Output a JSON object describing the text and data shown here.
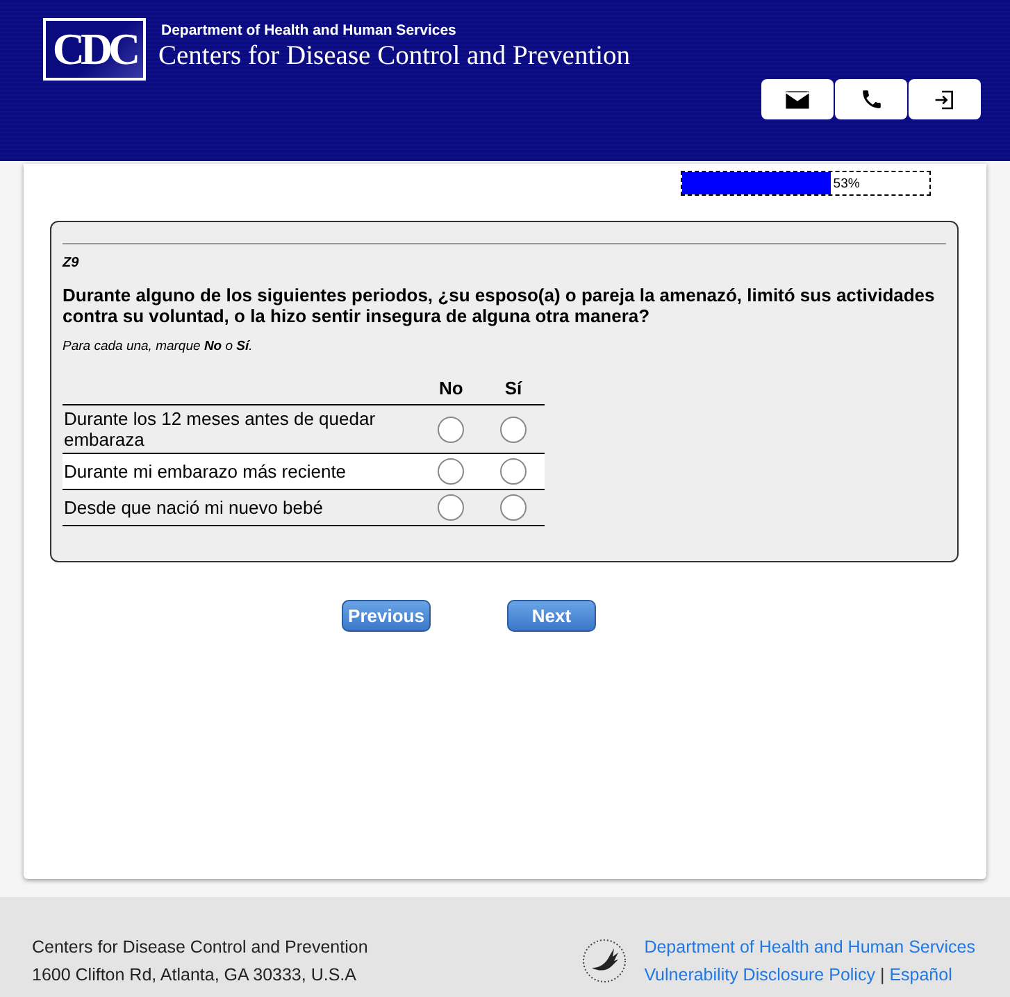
{
  "header": {
    "logo": "CDC",
    "department": "Department of Health and Human Services",
    "agency": "Centers for Disease Control and Prevention",
    "actions": [
      {
        "kind": "email"
      },
      {
        "kind": "phone"
      },
      {
        "kind": "exit"
      }
    ]
  },
  "progress": {
    "level": 0.6,
    "reading": "53%"
  },
  "question": {
    "code": "Z9",
    "text": "Durante alguno de los siguientes periodos, ¿su esposo(a) o pareja la amenazó, limitó sus actividades contra su voluntad, o la hizo sentir insegura de alguna otra manera?",
    "instruction": "Para cada una, marque **No** o **Sí**.",
    "columns": [
      "No",
      "Sí"
    ],
    "rows": [
      {
        "label": "Durante los 12 meses antes de quedar embaraza",
        "highlighted": false,
        "options": [
          {
            "checked": false
          },
          {
            "checked": false
          }
        ]
      },
      {
        "label": "Durante mi embarazo más reciente",
        "highlighted": true,
        "options": [
          {
            "checked": false
          },
          {
            "checked": false
          }
        ]
      },
      {
        "label": "Desde que nació mi nuevo bebé",
        "highlighted": false,
        "options": [
          {
            "checked": false
          },
          {
            "checked": false
          }
        ]
      }
    ]
  },
  "navigation": [
    "Previous",
    "Next"
  ],
  "footer": {
    "name": "Centers for Disease Control and Prevention",
    "address": "1600 Clifton Rd, Atlanta, GA 30333, U.S.A",
    "links": [
      "Department of Health and Human Services",
      "Vulnerability Disclosure Policy",
      "Español"
    ],
    "separator": "|"
  }
}
